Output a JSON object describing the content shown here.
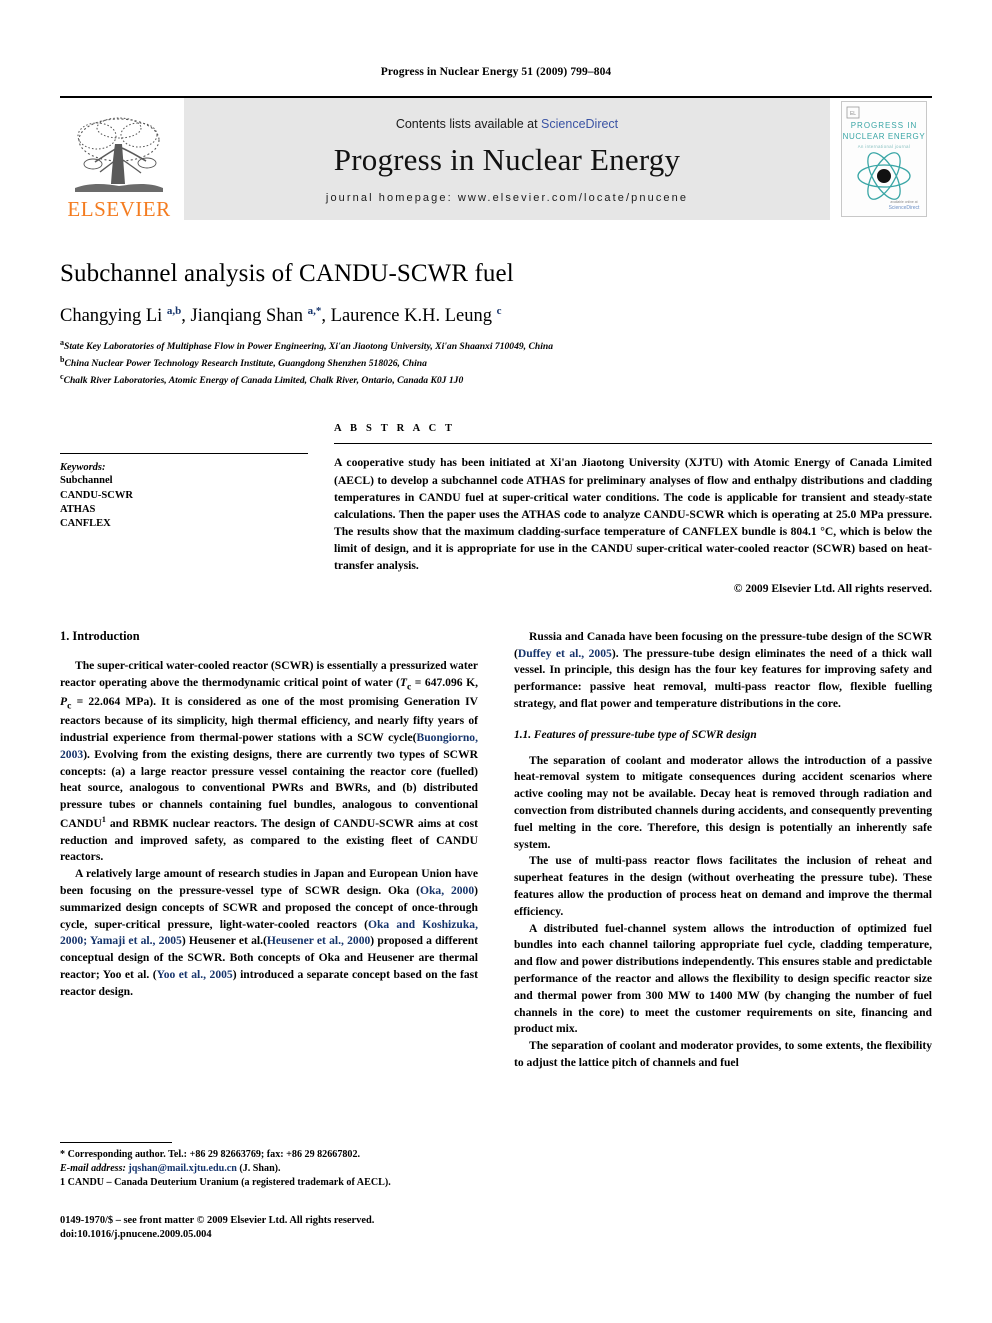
{
  "running_head": "Progress in Nuclear Energy 51 (2009) 799–804",
  "masthead": {
    "publisher_name": "ELSEVIER",
    "contents_prefix": "Contents lists available at ",
    "contents_link": "ScienceDirect",
    "journal_name": "Progress in Nuclear Energy",
    "homepage": "journal homepage: www.elsevier.com/locate/pnucene",
    "cover": {
      "line1": "PROGRESS IN",
      "line2": "NUCLEAR ENERGY",
      "subtitle": "An international journal",
      "footer": "ScienceDirect",
      "accent_color": "#3aa6a6"
    }
  },
  "article": {
    "title": "Subchannel analysis of CANDU-SCWR fuel",
    "authors_html": "Changying Li <sup>a,b</sup>, Jianqiang Shan <sup>a,*</sup>, Laurence K.H. Leung <sup>c</sup>",
    "affiliations": [
      {
        "marker": "a",
        "text": "State Key Laboratories of Multiphase Flow in Power Engineering, Xi'an Jiaotong University, Xi'an Shaanxi 710049, China"
      },
      {
        "marker": "b",
        "text": "China Nuclear Power Technology Research Institute, Guangdong  Shenzhen 518026, China"
      },
      {
        "marker": "c",
        "text": "Chalk River Laboratories, Atomic Energy of Canada Limited, Chalk River, Ontario, Canada K0J 1J0"
      }
    ]
  },
  "keywords": {
    "heading": "Keywords:",
    "items": [
      "Subchannel",
      "CANDU-SCWR",
      "ATHAS",
      "CANFLEX"
    ]
  },
  "abstract": {
    "heading": "A B S T R A C T",
    "text": "A cooperative study has been initiated at Xi'an Jiaotong University (XJTU) with Atomic Energy of Canada Limited (AECL) to develop a subchannel code ATHAS for preliminary analyses of flow and enthalpy distributions and cladding temperatures in CANDU fuel at super-critical water conditions. The code is applicable for transient and steady-state calculations. Then the paper uses the ATHAS code to analyze CANDU-SCWR which is operating at 25.0 MPa pressure. The results show that the maximum cladding-surface temperature of CANFLEX bundle is 804.1 °C, which is below the limit of design, and it is appropriate for use in the CANDU super-critical water-cooled reactor (SCWR) based on heat-transfer analysis.",
    "copyright": "© 2009 Elsevier Ltd. All rights reserved."
  },
  "sections": {
    "intro_heading": "1.  Introduction",
    "left_paragraphs": [
      "The super-critical water-cooled reactor (SCWR) is essentially a pressurized water reactor operating above the thermodynamic critical point of water (<i>T</i><sub>c</sub> = 647.096 K,  <i>P</i><sub>c</sub> = 22.064 MPa). It is considered as one of the most promising Generation IV reactors because of its simplicity, high thermal efficiency, and nearly fifty years of industrial experience from thermal-power stations with a SCW cycle(<span class=\"cite\">Buongiorno, 2003</span>). Evolving from the existing designs, there are currently two types of SCWR concepts: (a) a large reactor pressure vessel containing the reactor core (fuelled) heat source, analogous to conventional PWRs and BWRs, and (b) distributed pressure tubes or channels containing fuel bundles, analogous to conventional CANDU<sup class=\"fn\">1</sup> and RBMK nuclear reactors. The design of CANDU-SCWR aims at cost reduction and improved safety, as compared to the existing fleet of CANDU reactors.",
      "A relatively large amount of research studies in Japan and European Union have been focusing on the pressure-vessel type of SCWR design. Oka (<span class=\"cite\">Oka, 2000</span>) summarized design concepts of SCWR and proposed the concept of once-through cycle, super-critical pressure, light-water-cooled reactors (<span class=\"cite\">Oka and Koshizuka, 2000; Yamaji et al., 2005</span>) Heusener et al.(<span class=\"cite\">Heusener et al., 2000</span>) proposed a different conceptual design of the SCWR. Both concepts of Oka and Heusener are thermal reactor; Yoo et al. (<span class=\"cite\">Yoo et al., 2005</span>) introduced a separate concept based on the fast reactor design."
    ],
    "right_paragraph_top": "Russia and Canada have been focusing on the pressure-tube design of the SCWR (<span class=\"cite\">Duffey et al., 2005</span>). The pressure-tube design eliminates the need of a thick wall vessel. In principle, this design has the four key features for improving safety and performance: passive heat removal, multi-pass reactor flow, flexible fuelling strategy, and flat power and temperature distributions in the core.",
    "subsec_heading": "1.1.  Features of pressure-tube type of SCWR design",
    "right_paragraphs": [
      "The separation of coolant and moderator allows the introduction of a passive heat-removal system to mitigate consequences during accident scenarios where active cooling may not be available. Decay heat is removed through radiation and convection from distributed channels during accidents, and consequently preventing fuel melting in the core. Therefore, this design is potentially an inherently safe system.",
      "The use of multi-pass reactor flows facilitates the inclusion of reheat and superheat features in the design (without overheating the pressure tube). These features allow the production of process heat on demand and improve the thermal efficiency.",
      "A distributed fuel-channel system allows the introduction of optimized fuel bundles into each channel tailoring appropriate fuel cycle, cladding temperature, and flow and power distributions independently. This ensures stable and predictable performance of the reactor and allows the flexibility to design specific reactor size and thermal power from 300 MW to 1400 MW (by changing the number of fuel channels in the core) to meet the customer requirements on site, financing and product mix.",
      "The separation of coolant and moderator provides, to some extents, the flexibility to adjust the lattice pitch of channels and fuel"
    ]
  },
  "footnotes": [
    "*  Corresponding author. Tel.: +86 29 82663769; fax: +86 29 82667802.",
    "1  CANDU – Canada Deuterium Uranium (a registered trademark of AECL)."
  ],
  "email_note": {
    "label": "E-mail address:",
    "address": "jqshan@mail.xjtu.edu.cn",
    "suffix": "(J. Shan)."
  },
  "colophon": {
    "line1": "0149-1970/$ – see front matter © 2009 Elsevier Ltd. All rights reserved.",
    "line2": "doi:10.1016/j.pnucene.2009.05.004"
  }
}
